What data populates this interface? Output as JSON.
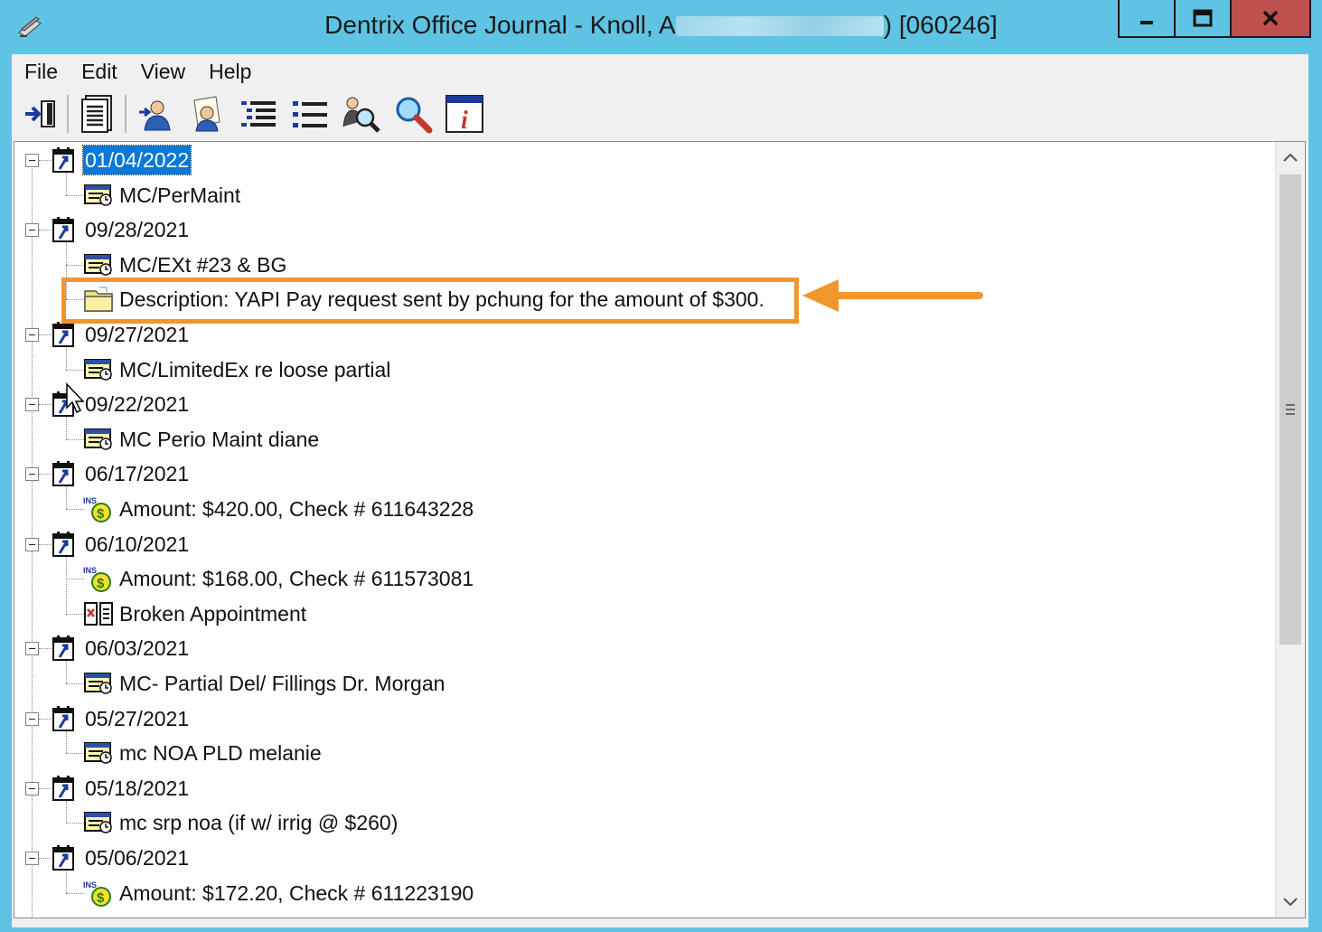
{
  "window": {
    "title_prefix": "Dentrix Office Journal - Knoll, A",
    "title_suffix": ") [060246]"
  },
  "menu": [
    "File",
    "Edit",
    "View",
    "Help"
  ],
  "toolbar": {
    "buttons": [
      "exit-icon",
      "report-icon",
      "patient-select-icon",
      "provider-icon",
      "expand-all-icon",
      "collapse-all-icon",
      "find-patient-icon",
      "search-icon",
      "info-icon"
    ]
  },
  "tree": {
    "nodes": [
      {
        "type": "date",
        "text": "01/04/2022",
        "selected": true,
        "children": [
          {
            "type": "appt",
            "text": "MC/PerMaint"
          }
        ]
      },
      {
        "type": "date",
        "text": "09/28/2021",
        "children": [
          {
            "type": "appt",
            "text": "MC/EXt #23 & BG"
          },
          {
            "type": "note",
            "text": "Description: YAPI Pay request sent by pchung for the amount of $300."
          }
        ]
      },
      {
        "type": "date",
        "text": "09/27/2021",
        "children": [
          {
            "type": "appt",
            "text": "MC/LimitedEx re loose partial"
          }
        ]
      },
      {
        "type": "date",
        "text": "09/22/2021",
        "children": [
          {
            "type": "appt",
            "text": "MC Perio Maint diane"
          }
        ]
      },
      {
        "type": "date",
        "text": "06/17/2021",
        "children": [
          {
            "type": "ins",
            "text": "Amount: $420.00, Check # 611643228"
          }
        ]
      },
      {
        "type": "date",
        "text": "06/10/2021",
        "children": [
          {
            "type": "ins",
            "text": "Amount: $168.00, Check # 611573081"
          },
          {
            "type": "broken",
            "text": "Broken Appointment"
          }
        ]
      },
      {
        "type": "date",
        "text": "06/03/2021",
        "children": [
          {
            "type": "appt",
            "text": "MC- Partial Del/ Fillings Dr. Morgan"
          }
        ]
      },
      {
        "type": "date",
        "text": "05/27/2021",
        "children": [
          {
            "type": "appt",
            "text": "mc NOA PLD melanie"
          }
        ]
      },
      {
        "type": "date",
        "text": "05/18/2021",
        "children": [
          {
            "type": "appt",
            "text": "mc srp noa (if w/ irrig @ $260)"
          }
        ]
      },
      {
        "type": "date",
        "text": "05/06/2021",
        "children": [
          {
            "type": "ins",
            "text": "Amount: $172.20, Check # 611223190"
          }
        ]
      }
    ]
  },
  "colors": {
    "titlebar": "#5fc3e4",
    "selection": "#0a78d7",
    "highlight": "#f0962e",
    "close_button": "#c0504d"
  }
}
